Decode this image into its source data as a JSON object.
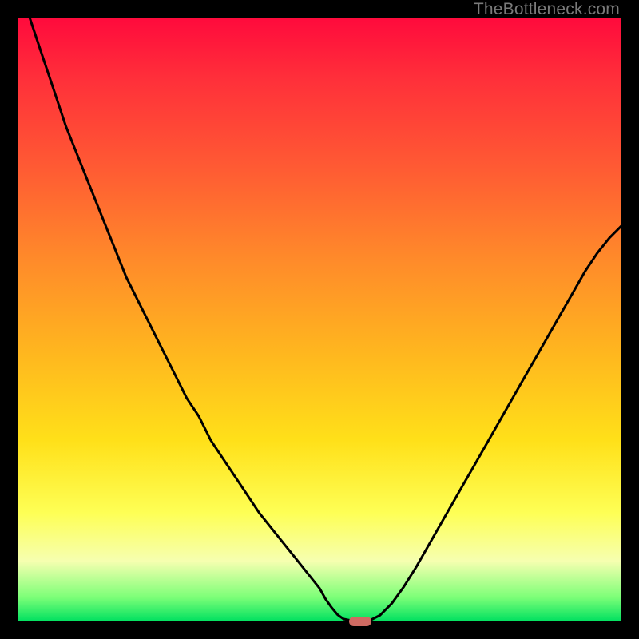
{
  "watermark": "TheBottleneck.com",
  "colors": {
    "curve_stroke": "#000000",
    "marker_fill": "#cf6a62",
    "frame_bg": "#000000"
  },
  "chart_data": {
    "type": "line",
    "title": "",
    "xlabel": "",
    "ylabel": "",
    "xlim": [
      0,
      100
    ],
    "ylim": [
      0,
      100
    ],
    "x": [
      2,
      4,
      6,
      8,
      10,
      12,
      14,
      16,
      18,
      20,
      22,
      24,
      26,
      28,
      30,
      32,
      34,
      36,
      38,
      40,
      42,
      44,
      46,
      48,
      50,
      51,
      52,
      53,
      54,
      56,
      58,
      60,
      62,
      64,
      66,
      68,
      70,
      72,
      74,
      76,
      78,
      80,
      82,
      84,
      86,
      88,
      90,
      92,
      94,
      96,
      98,
      100
    ],
    "values": [
      100,
      94,
      88,
      82,
      77,
      72,
      67,
      62,
      57,
      53,
      49,
      45,
      41,
      37,
      34,
      30,
      27,
      24,
      21,
      18,
      15.5,
      13,
      10.5,
      8,
      5.5,
      3.7,
      2.3,
      1.1,
      0.4,
      0.0,
      0.0,
      1.0,
      3.0,
      5.8,
      9.0,
      12.5,
      16.0,
      19.5,
      23.0,
      26.5,
      30.0,
      33.5,
      37.0,
      40.5,
      44.0,
      47.5,
      51.0,
      54.5,
      58.0,
      61.0,
      63.5,
      65.5
    ],
    "marker": {
      "x": 56.7,
      "y": 0
    },
    "annotations": []
  }
}
